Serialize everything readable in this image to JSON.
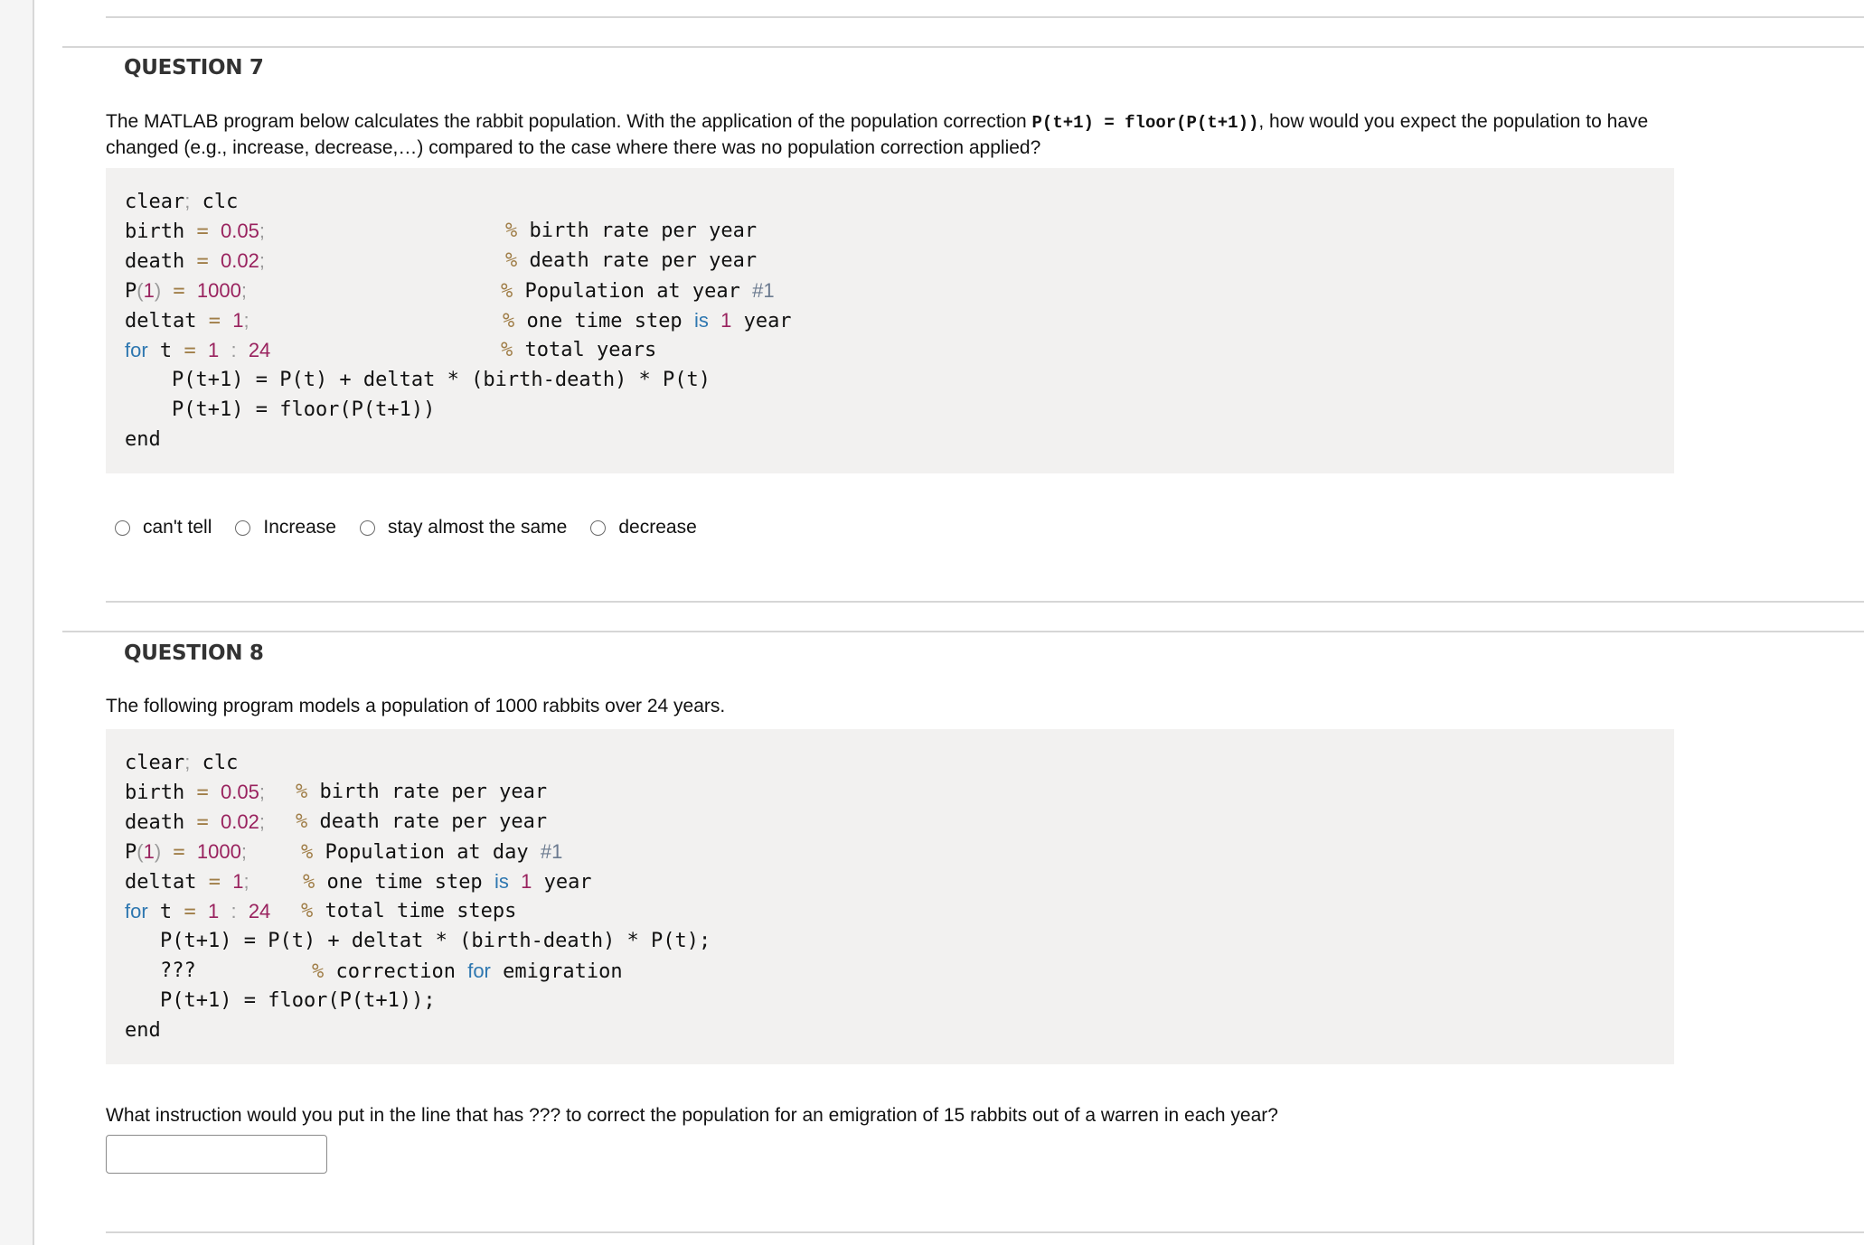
{
  "questions": [
    {
      "title": "QUESTION 7",
      "prompt_before": "The MATLAB program below calculates the rabbit population. With the application of the population correction ",
      "prompt_code": "P(t+1) = floor(P(t+1))",
      "prompt_after": ", how would you expect the population to have changed (e.g., increase, decrease,…) compared to the case where there was no population correction applied?",
      "code": {
        "l1": {
          "a": "clear",
          "b": ";",
          "c": " clc"
        },
        "l2": {
          "var": "birth",
          "eq": "=",
          "num": "0.05",
          "semi": ";",
          "pct": "%",
          "cmt": " birth rate per year"
        },
        "l3": {
          "var": "death",
          "eq": "=",
          "num": "0.02",
          "semi": ";",
          "pct": "%",
          "cmt": " death rate per year"
        },
        "l4": {
          "p": "P",
          "lp": "(",
          "i": "1",
          "rp": ")",
          "eq": "=",
          "num": "1000",
          "semi": ";",
          "pct": "%",
          "cmt": " Population at year ",
          "hash": "#1"
        },
        "l5": {
          "var": "deltat",
          "eq": "=",
          "num": "1",
          "semi": ";",
          "pct": "%",
          "cmt1": " one time step ",
          "kw": "is",
          "num2": "1",
          "cmt2": " year"
        },
        "l6": {
          "kw": "for",
          "var": " t ",
          "eq": "=",
          "n1": "1",
          "colon": ":",
          "n2": "24",
          "pct": "%",
          "cmt": " total years"
        },
        "l7": "P(t+1) = P(t) + deltat * (birth-death) * P(t)",
        "l8": "P(t+1) = floor(P(t+1))",
        "l9": "end"
      },
      "options": [
        "can't tell",
        "Increase",
        "stay almost the same",
        "decrease"
      ]
    },
    {
      "title": "QUESTION 8",
      "prompt": "The following program models a population of 1000 rabbits over 24 years.",
      "code": {
        "l1": {
          "a": "clear",
          "b": ";",
          "c": " clc"
        },
        "l2": {
          "var": "birth",
          "eq": "=",
          "num": "0.05",
          "semi": ";",
          "pct": "%",
          "cmt": " birth rate per year"
        },
        "l3": {
          "var": "death",
          "eq": "=",
          "num": "0.02",
          "semi": ";",
          "pct": "%",
          "cmt": " death rate per year"
        },
        "l4": {
          "p": "P",
          "lp": "(",
          "i": "1",
          "rp": ")",
          "eq": "=",
          "num": "1000",
          "semi": ";",
          "pct": "%",
          "cmt": " Population at day ",
          "hash": "#1"
        },
        "l5": {
          "var": "deltat",
          "eq": "=",
          "num": "1",
          "semi": ";",
          "pct": "%",
          "cmt1": " one time step ",
          "kw": "is",
          "num2": "1",
          "cmt2": " year"
        },
        "l6": {
          "kw": "for",
          "var": " t ",
          "eq": "=",
          "n1": "1",
          "colon": ":",
          "n2": "24",
          "pct": "%",
          "cmt": " total time steps"
        },
        "l7": "P(t+1) = P(t) + deltat * (birth-death) * P(t);",
        "l8": {
          "q": "???",
          "pct": "%",
          "cmt1": " correction ",
          "kw": "for",
          "cmt2": " emigration"
        },
        "l9": "P(t+1) = floor(P(t+1));",
        "l10": "end"
      },
      "followup": "What instruction would you put in the line that has ??? to correct the population for an emigration of 15 rabbits out of a warren in each year?",
      "answer_value": ""
    }
  ]
}
